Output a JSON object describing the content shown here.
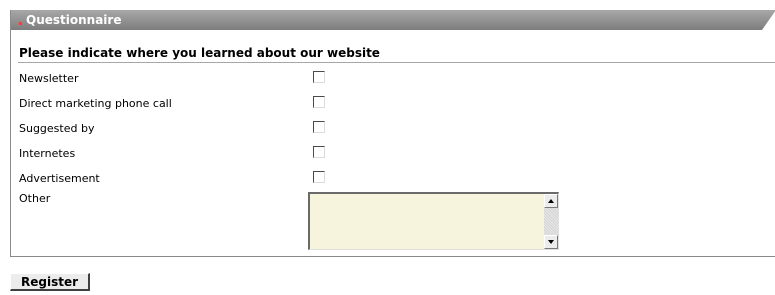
{
  "section": {
    "title": "Questionnaire",
    "colors": {
      "header": "#8c8c8c",
      "bullet": "#ff3a3a",
      "textarea_bg": "#f6f4dc"
    }
  },
  "question": {
    "heading": "Please indicate where you learned about our website",
    "options": [
      {
        "label": "Newsletter",
        "checked": false
      },
      {
        "label": "Direct marketing phone call",
        "checked": false
      },
      {
        "label": "Suggested by",
        "checked": false
      },
      {
        "label": "Internetes",
        "checked": false
      },
      {
        "label": "Advertisement",
        "checked": false
      }
    ],
    "other": {
      "label": "Other",
      "value": ""
    }
  },
  "actions": {
    "register_label": "Register"
  }
}
